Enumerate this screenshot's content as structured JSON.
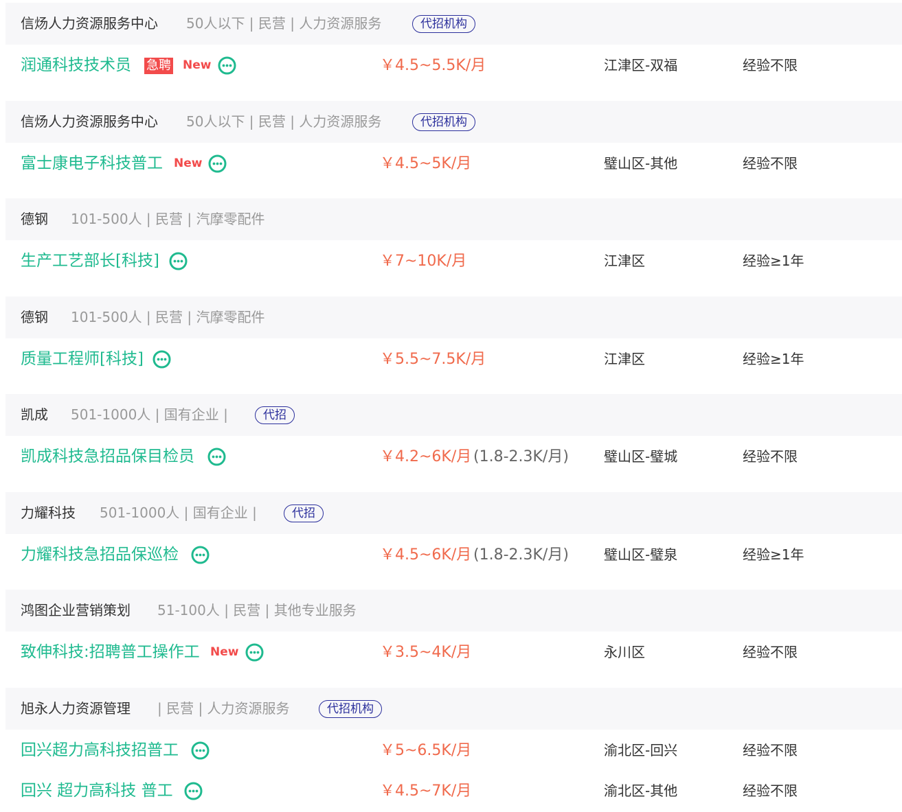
{
  "listings": [
    {
      "company": "信炀人力资源服务中心",
      "meta": "50人以下 | 民营 | 人力资源服务",
      "agency": "代招机构",
      "title": "润通科技技术员",
      "urgent": "急聘",
      "new": "New",
      "salary": "￥4.5~5.5K/月",
      "salary_sub": "",
      "location": "江津区-双福",
      "experience": "经验不限"
    },
    {
      "company": "信炀人力资源服务中心",
      "meta": "50人以下 | 民营 | 人力资源服务",
      "agency": "代招机构",
      "title": "富士康电子科技普工",
      "urgent": "",
      "new": "New",
      "salary": "￥4.5~5K/月",
      "salary_sub": "",
      "location": "璧山区-其他",
      "experience": "经验不限"
    },
    {
      "company": "德钢",
      "meta": "101-500人 | 民营 | 汽摩零配件",
      "agency": "",
      "title": "生产工艺部长[科技]",
      "urgent": "",
      "new": "",
      "salary": "￥7~10K/月",
      "salary_sub": "",
      "location": "江津区",
      "experience": "经验≥1年"
    },
    {
      "company": "德钢",
      "meta": "101-500人 | 民营 | 汽摩零配件",
      "agency": "",
      "title": "质量工程师[科技]",
      "urgent": "",
      "new": "",
      "salary": "￥5.5~7.5K/月",
      "salary_sub": "",
      "location": "江津区",
      "experience": "经验≥1年"
    },
    {
      "company": "凯成",
      "meta": "501-1000人 | 国有企业 |",
      "agency": "代招",
      "title": "凯成科技急招品保目检员",
      "urgent": "",
      "new": "",
      "salary": "￥4.2~6K/月",
      "salary_sub": "(1.8-2.3K/月)",
      "location": "璧山区-璧城",
      "experience": "经验不限"
    },
    {
      "company": "力耀科技",
      "meta": "501-1000人 | 国有企业 |",
      "agency": "代招",
      "title": "力耀科技急招品保巡检",
      "urgent": "",
      "new": "",
      "salary": "￥4.5~6K/月",
      "salary_sub": "(1.8-2.3K/月)",
      "location": "璧山区-璧泉",
      "experience": "经验≥1年"
    },
    {
      "company": "鸿图企业营销策划",
      "meta": "51-100人 | 民营 | 其他专业服务",
      "agency": "",
      "title": "致伸科技:招聘普工操作工",
      "urgent": "",
      "new": "New",
      "salary": "￥3.5~4K/月",
      "salary_sub": "",
      "location": "永川区",
      "experience": "经验不限"
    },
    {
      "company": "旭永人力资源管理",
      "meta": "| 民营 | 人力资源服务",
      "agency": "代招机构",
      "title": "回兴超力高科技招普工",
      "urgent": "",
      "new": "",
      "salary": "￥5~6.5K/月",
      "salary_sub": "",
      "location": "渝北区-回兴",
      "experience": "经验不限"
    }
  ],
  "extra_row": {
    "title": "回兴 超力高科技 普工",
    "salary": "￥4.5~7K/月",
    "location": "渝北区-其他",
    "experience": "经验不限"
  },
  "colors": {
    "title_green": "#1fba8f",
    "salary_red": "#f06a4c",
    "agency_blue": "#2b2f9c",
    "badge_red": "#f24b4b"
  },
  "icons": {
    "chat": "chat-bubble-icon"
  }
}
